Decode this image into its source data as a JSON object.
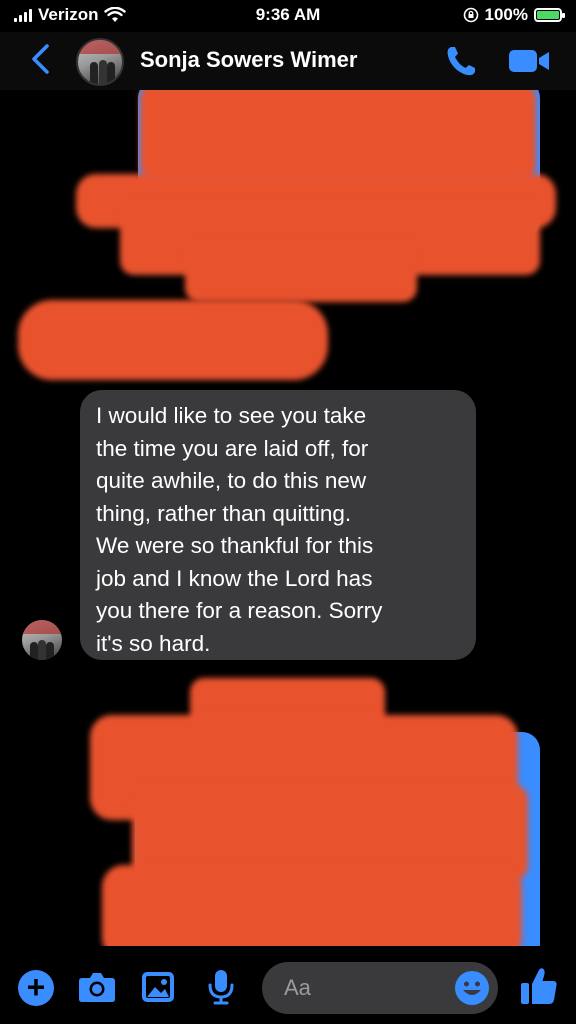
{
  "status_bar": {
    "carrier": "Verizon",
    "time": "9:36 AM",
    "battery": "100%"
  },
  "header": {
    "contact_name": "Sonja Sowers Wimer"
  },
  "messages": [
    {
      "from": "contact",
      "text": "I would like to see you take\nthe time you are laid off, for\nquite awhile, to do this new\nthing, rather than quitting.\nWe were so thankful for this\njob and I know the Lord has\nyou there for a reason.  Sorry\nit's so hard."
    }
  ],
  "composer": {
    "placeholder": "Aa"
  },
  "colors": {
    "accent": "#3a8dff",
    "incoming_bubble": "#3a3a3c",
    "redaction": "#e8532e",
    "background": "#000000"
  },
  "icons": [
    "back-chevron-icon",
    "phone-icon",
    "video-camera-icon",
    "plus-icon",
    "camera-icon",
    "photo-icon",
    "microphone-icon",
    "emoji-icon",
    "thumbs-up-icon"
  ]
}
